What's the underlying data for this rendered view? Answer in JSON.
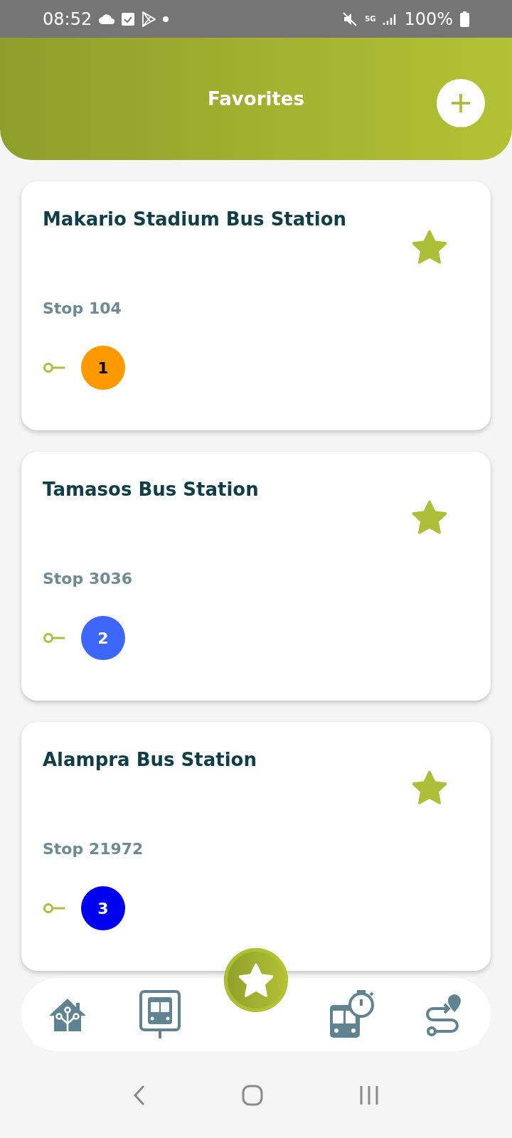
{
  "status_bar": {
    "time": "08:52",
    "network": "5G",
    "battery": "100%"
  },
  "header": {
    "title": "Favorites"
  },
  "favorites": [
    {
      "name": "Makario Stadium Bus Station",
      "stop": "Stop 104",
      "route": "1",
      "color": "#ff9900",
      "favorite": true
    },
    {
      "name": "Tamasos Bus Station",
      "stop": "Stop 3036",
      "route": "2",
      "color": "#3d66fa",
      "favorite": true
    },
    {
      "name": "Alampra Bus Station",
      "stop": "Stop 21972",
      "route": "3",
      "color": "#0000ee",
      "favorite": true
    }
  ],
  "bottom_nav": [
    {
      "kind": "home",
      "selected": false
    },
    {
      "kind": "stop",
      "selected": false
    },
    {
      "kind": "favorites",
      "selected": true
    },
    {
      "kind": "timetable",
      "selected": false
    },
    {
      "kind": "route",
      "selected": false
    }
  ]
}
